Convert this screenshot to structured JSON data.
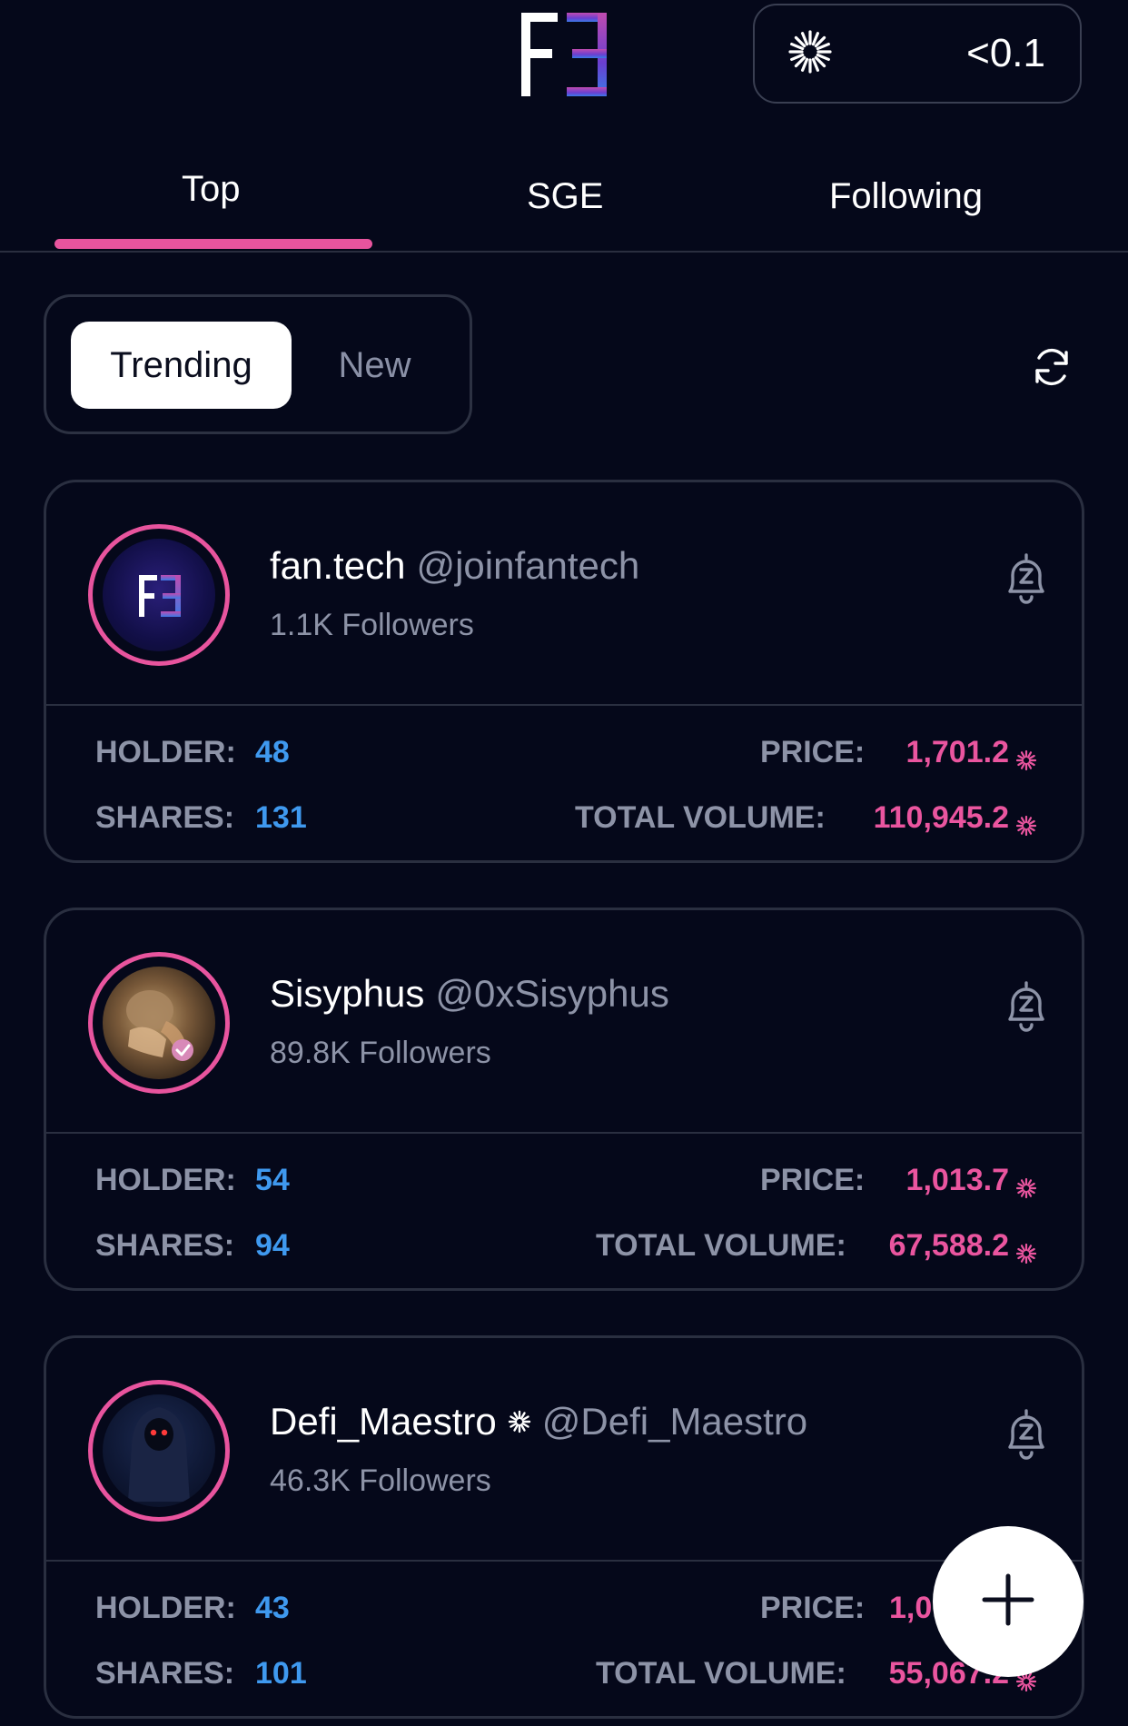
{
  "header": {
    "logo_icon": "fantech-logo",
    "balance": {
      "icon": "sun-icon",
      "value": "<0.1"
    }
  },
  "tabs": [
    {
      "label": "Top",
      "active": true
    },
    {
      "label": "SGE",
      "active": false
    },
    {
      "label": "Following",
      "active": false
    }
  ],
  "filter": {
    "options": [
      {
        "label": "Trending",
        "selected": true
      },
      {
        "label": "New",
        "selected": false
      }
    ],
    "refresh_icon": "refresh-icon"
  },
  "labels": {
    "holder": "HOLDER:",
    "shares": "SHARES:",
    "price": "PRICE:",
    "total_volume": "TOTAL VOLUME:"
  },
  "cards": [
    {
      "name": "fan.tech",
      "handle": "@joinfantech",
      "followers": "1.1K Followers",
      "holder": "48",
      "shares": "131",
      "price": "1,701.2",
      "total_volume": "110,945.2"
    },
    {
      "name": "Sisyphus",
      "handle": "@0xSisyphus",
      "followers": "89.8K Followers",
      "holder": "54",
      "shares": "94",
      "price": "1,013.7",
      "total_volume": "67,588.2"
    },
    {
      "name": "Defi_Maestro",
      "handle": "@Defi_Maestro",
      "followers": "46.3K Followers",
      "holder": "43",
      "shares": "101",
      "price": "1,0",
      "total_volume": "55,067.2"
    }
  ],
  "colors": {
    "background": "#05081a",
    "accent_pink": "#e8549e",
    "accent_blue": "#3f99ef",
    "muted": "#8d93a7"
  },
  "fab_icon": "plus-icon"
}
